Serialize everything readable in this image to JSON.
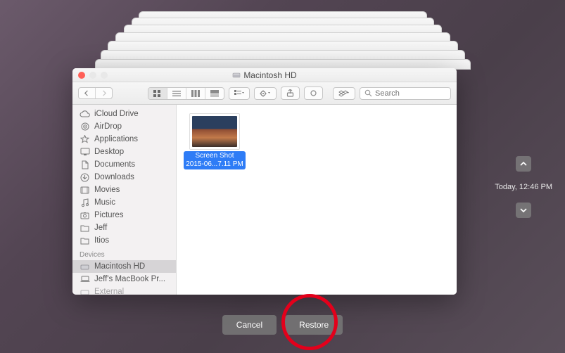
{
  "window": {
    "title": "Macintosh HD"
  },
  "toolbar": {
    "search_placeholder": "Search"
  },
  "sidebar": {
    "favorites": [
      {
        "icon": "cloud",
        "label": "iCloud Drive"
      },
      {
        "icon": "airdrop",
        "label": "AirDrop"
      },
      {
        "icon": "apps",
        "label": "Applications"
      },
      {
        "icon": "desktop",
        "label": "Desktop"
      },
      {
        "icon": "documents",
        "label": "Documents"
      },
      {
        "icon": "downloads",
        "label": "Downloads"
      },
      {
        "icon": "movies",
        "label": "Movies"
      },
      {
        "icon": "music",
        "label": "Music"
      },
      {
        "icon": "pictures",
        "label": "Pictures"
      },
      {
        "icon": "folder",
        "label": "Jeff"
      },
      {
        "icon": "folder",
        "label": "Itios"
      }
    ],
    "devices_header": "Devices",
    "devices": [
      {
        "icon": "disk",
        "label": "Macintosh HD",
        "selected": true
      },
      {
        "icon": "laptop",
        "label": "Jeff's MacBook Pr...",
        "selected": false
      },
      {
        "icon": "disk",
        "label": "External",
        "selected": false
      }
    ]
  },
  "file": {
    "line1": "Screen Shot",
    "line2": "2015-06...7.11 PM"
  },
  "timeline": {
    "label": "Today, 12:46 PM"
  },
  "buttons": {
    "cancel": "Cancel",
    "restore": "Restore"
  }
}
